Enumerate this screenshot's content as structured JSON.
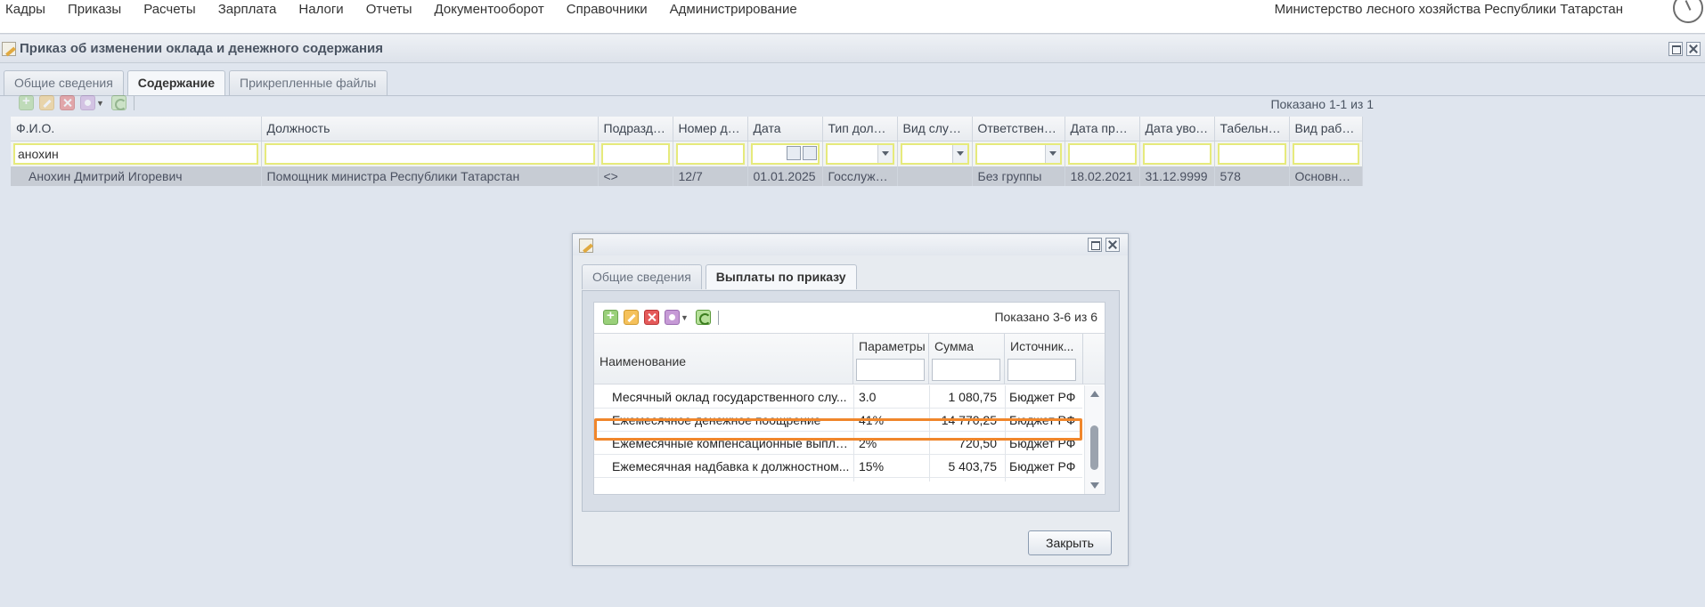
{
  "topmenu": {
    "items": [
      "Кадры",
      "Приказы",
      "Расчеты",
      "Зарплата",
      "Налоги",
      "Отчеты",
      "Документооборот",
      "Справочники",
      "Администрирование"
    ],
    "organization": "Министерство лесного хозяйства Республики Татарстан"
  },
  "main_window": {
    "title": "Приказ об изменении оклада и денежного содержания",
    "tabs": [
      "Общие сведения",
      "Содержание",
      "Прикрепленные файлы"
    ],
    "active_tab": "Содержание",
    "shown_text": "Показано 1-1 из 1",
    "columns": [
      "Ф.И.О.",
      "Должность",
      "Подразделе...",
      "Номер доп. ...",
      "Дата",
      "Тип должно...",
      "Вид служащ...",
      "Ответственный ...",
      "Дата приема",
      "Дата увольн...",
      "Табельный ...",
      "Вид работы"
    ],
    "filter_value": "анохин",
    "row": [
      "Анохин Дмитрий Игоревич",
      "Помощник министра Республики Татарстан",
      "<>",
      "12/7",
      "01.01.2025",
      "Госслужащие",
      "",
      "Без группы",
      "18.02.2021",
      "31.12.9999",
      "578",
      "Основная р..."
    ]
  },
  "modal": {
    "tabs": [
      "Общие сведения",
      "Выплаты по приказу"
    ],
    "active_tab": "Выплаты по приказу",
    "shown_text": "Показано 3-6 из 6",
    "columns": [
      "Наименование",
      "Параметры",
      "Сумма",
      "Источник..."
    ],
    "rows": [
      [
        "Месячный оклад государственного слу...",
        "3.0",
        "1 080,75",
        "Бюджет РФ"
      ],
      [
        "Ежемесячное денежное поощрение",
        "41%",
        "14 770,25",
        "Бюджет РФ"
      ],
      [
        "Ежемесячные компенсационные выпла...",
        "2%",
        "720,50",
        "Бюджет РФ"
      ],
      [
        "Ежемесячная надбавка к должностном...",
        "15%",
        "5 403,75",
        "Бюджет РФ"
      ]
    ],
    "highlighted_row": 1,
    "highlight_color": "#f0862b",
    "close_label": "Закрыть"
  }
}
